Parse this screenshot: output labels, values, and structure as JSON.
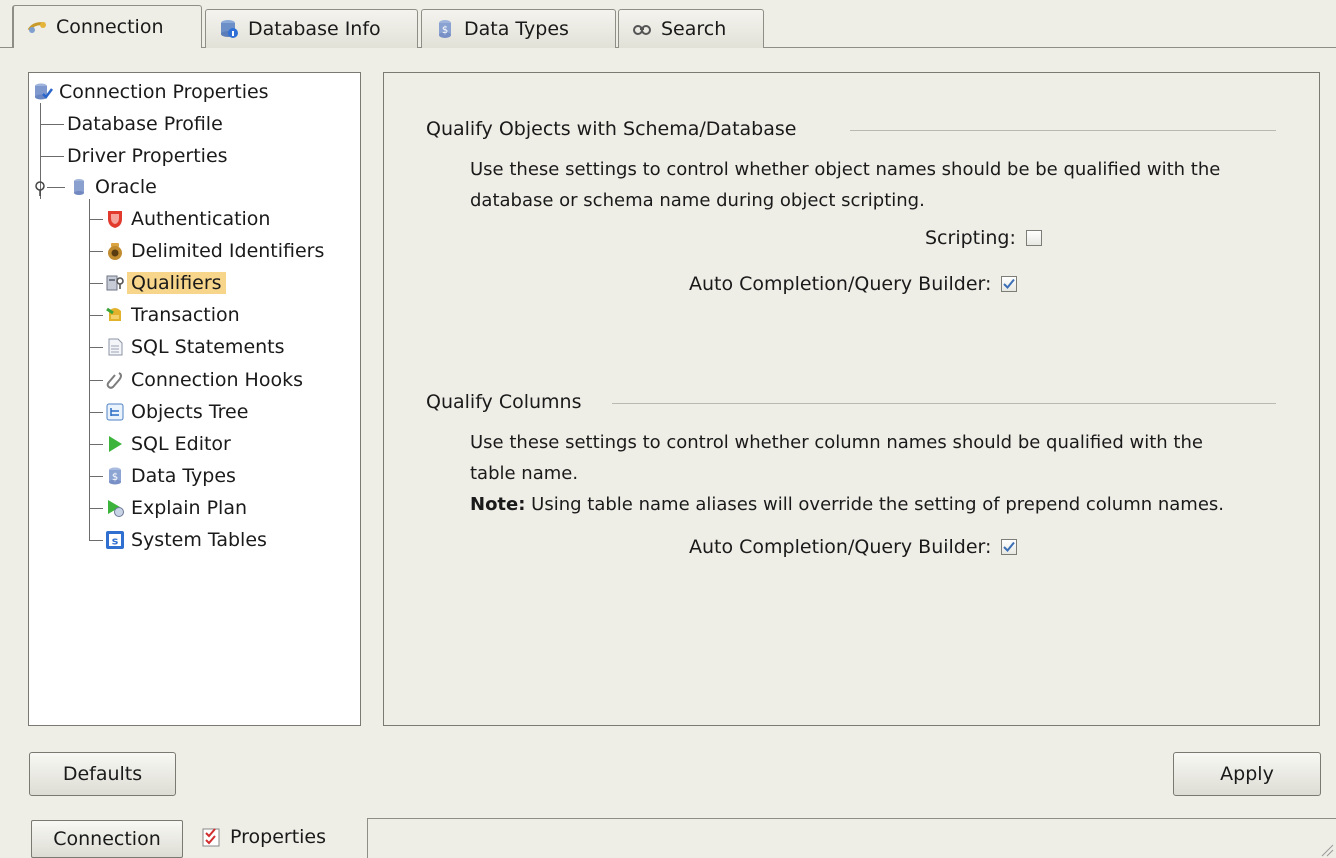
{
  "tabs": [
    {
      "label": "Connection",
      "icon": "connection-icon",
      "active": true
    },
    {
      "label": "Database Info",
      "icon": "database-info-icon",
      "active": false
    },
    {
      "label": "Data Types",
      "icon": "data-types-icon",
      "active": false
    },
    {
      "label": "Search",
      "icon": "search-icon",
      "active": false
    }
  ],
  "tree": {
    "root": "Connection Properties",
    "children": [
      "Database Profile",
      "Driver Properties"
    ],
    "oracle": "Oracle",
    "oracle_children": [
      {
        "label": "Authentication",
        "icon": "shield-icon"
      },
      {
        "label": "Delimited Identifiers",
        "icon": "jar-icon"
      },
      {
        "label": "Qualifiers",
        "icon": "qualifier-icon",
        "selected": true
      },
      {
        "label": "Transaction",
        "icon": "transaction-icon"
      },
      {
        "label": "SQL Statements",
        "icon": "document-icon"
      },
      {
        "label": "Connection Hooks",
        "icon": "hook-icon"
      },
      {
        "label": "Objects Tree",
        "icon": "tree-icon"
      },
      {
        "label": "SQL Editor",
        "icon": "play-icon"
      },
      {
        "label": "Data Types",
        "icon": "data-types-icon"
      },
      {
        "label": "Explain Plan",
        "icon": "explain-plan-icon"
      },
      {
        "label": "System Tables",
        "icon": "system-tables-icon"
      }
    ]
  },
  "qualify_objects": {
    "title": "Qualify Objects with Schema/Database",
    "desc_line1": "Use these settings to control whether object names should be be qualified with the",
    "desc_line2": "database or schema name during object scripting.",
    "scripting_label": "Scripting:",
    "scripting_checked": false,
    "autocomplete_label": "Auto Completion/Query Builder:",
    "autocomplete_checked": true
  },
  "qualify_columns": {
    "title": "Qualify Columns",
    "desc_line1": "Use these settings to control whether column names should be qualified with the",
    "desc_line2": "table name.",
    "note_label": "Note:",
    "note_text": " Using table name aliases will override the setting of prepend column names.",
    "autocomplete_label": "Auto Completion/Query Builder:",
    "autocomplete_checked": true
  },
  "buttons": {
    "defaults": "Defaults",
    "apply": "Apply"
  },
  "bottom_bar": {
    "connection": "Connection",
    "properties": "Properties"
  },
  "colors": {
    "background": "#eeede6",
    "selection": "#f7d58a",
    "check": "#3b6fb6"
  }
}
